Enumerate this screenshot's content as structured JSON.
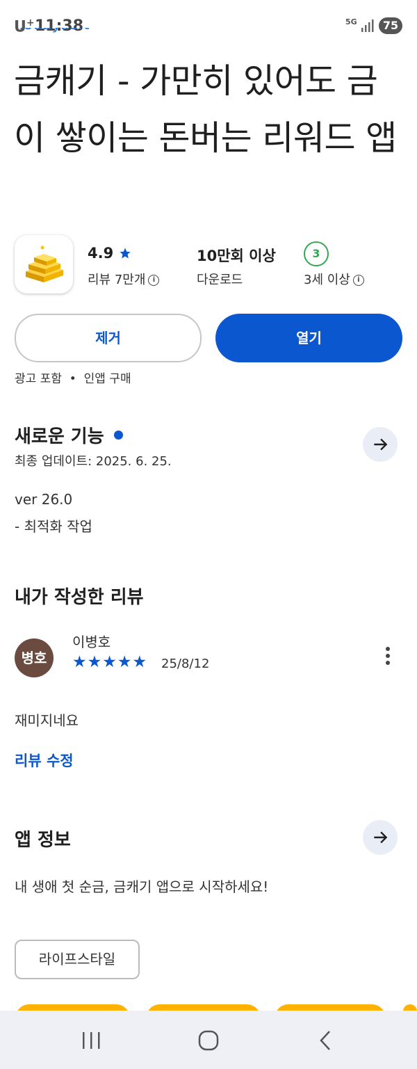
{
  "status_bar": {
    "carrier": "U",
    "carrier_sup": "+",
    "time": "11:38",
    "network": "5G",
    "battery": "75"
  },
  "developer_cropped": "Todaysoft",
  "app": {
    "title": "금캐기 - 가만히 있어도 금이 쌓이는 돈버는 리워드 앱",
    "rating": "4.9",
    "reviews_label": "리뷰 7만개",
    "downloads": "10만회 이상",
    "downloads_label": "다운로드",
    "age_rating": "3",
    "age_label": "3세 이상"
  },
  "buttons": {
    "remove": "제거",
    "open": "열기"
  },
  "badges": [
    "광고 포함",
    "•",
    "인앱 구매"
  ],
  "whats_new": {
    "title": "새로운 기능",
    "updated": "최종 업데이트: 2025. 6. 25.",
    "version": "ver 26.0",
    "notes": "- 최적화 작업"
  },
  "my_review": {
    "title": "내가 작성한 리뷰",
    "avatar_text": "병호",
    "author": "이병호",
    "stars": 5,
    "stars_text": "★★★★★",
    "date": "25/8/12",
    "text": "재미지네요",
    "edit_link": "리뷰 수정"
  },
  "about": {
    "title": "앱 정보",
    "description": "내 생애 첫 순금, 금캐기 앱으로 시작하세요!",
    "category_chip": "라이프스타일"
  },
  "icons": {
    "star": "star-icon",
    "info": "info-icon",
    "arrow": "arrow-right-icon",
    "more": "more-vert-icon",
    "recents": "recent-apps-icon",
    "home": "home-icon",
    "back": "back-icon"
  },
  "colors": {
    "accent": "#0b57d0",
    "age_green": "#34a853",
    "avatar_bg": "#6b4a3f",
    "card_orange": "#ffb300"
  }
}
